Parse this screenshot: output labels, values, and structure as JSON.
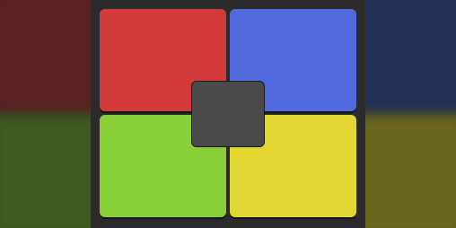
{
  "game": {
    "pads": [
      {
        "name": "red",
        "color": "#d23b3b"
      },
      {
        "name": "blue",
        "color": "#536ade"
      },
      {
        "name": "green",
        "color": "#89cf3a"
      },
      {
        "name": "yellow",
        "color": "#e3d633"
      }
    ],
    "center_button": {
      "color": "#4a4a4a"
    },
    "background": {
      "colors": {
        "top_left": "#5a2222",
        "top_right": "#233256",
        "bottom_left": "#3f5a22",
        "bottom_right": "#6a661f"
      }
    }
  }
}
